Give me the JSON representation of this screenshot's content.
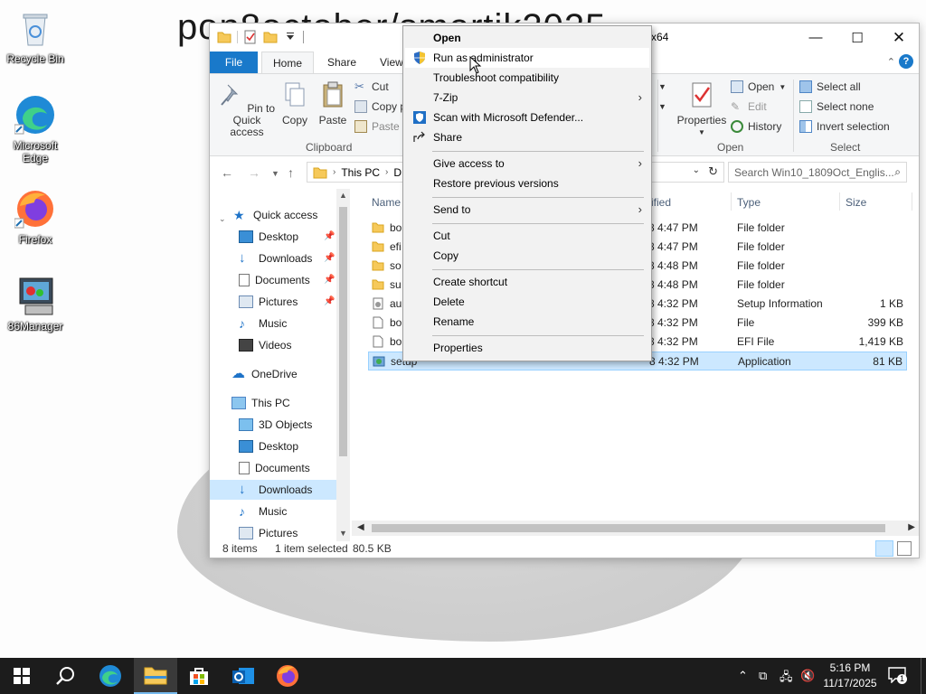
{
  "desktop": {
    "wallpaper_text": "pon8october/smartik2025",
    "icons": [
      {
        "label": "Recycle Bin",
        "icon": "recycle-bin-icon"
      },
      {
        "label": "Microsoft Edge",
        "icon": "edge-icon"
      },
      {
        "label": "Firefox",
        "icon": "firefox-icon"
      },
      {
        "label": "86Manager",
        "icon": "86manager-icon"
      }
    ]
  },
  "window": {
    "title": "x64",
    "controls": {
      "minimize": "—",
      "maximize": "☐",
      "close": "✕"
    },
    "tabs": [
      "File",
      "Home",
      "Share",
      "View"
    ],
    "active_tab": "Home",
    "ribbon": {
      "pin_label": "Pin to Quick access",
      "copy_label": "Copy",
      "paste_label": "Paste",
      "cut_label": "Cut",
      "copy_path_label": "Copy p",
      "paste_shortcut_label": "Paste s",
      "clipboard_group": "Clipboard",
      "properties_label": "Properties",
      "open_label": "Open",
      "edit_label": "Edit",
      "history_label": "History",
      "open_group": "Open",
      "select_all": "Select all",
      "select_none": "Select none",
      "invert_selection": "Invert selection",
      "select_group": "Select"
    },
    "address": {
      "path_root": "This PC",
      "path_next": "D"
    },
    "search_placeholder": "Search Win10_1809Oct_Englis...",
    "nav": {
      "quick_access": "Quick access",
      "quick_items": [
        "Desktop",
        "Downloads",
        "Documents",
        "Pictures",
        "Music",
        "Videos"
      ],
      "onedrive": "OneDrive",
      "this_pc": "This PC",
      "pc_items": [
        "3D Objects",
        "Desktop",
        "Documents",
        "Downloads",
        "Music",
        "Pictures"
      ],
      "selected": "Downloads"
    },
    "columns": {
      "name": "Name",
      "modified": "ified",
      "type": "Type",
      "size": "Size"
    },
    "files": [
      {
        "name": "bo",
        "modified": "8 4:47 PM",
        "type": "File folder",
        "size": "",
        "kind": "folder"
      },
      {
        "name": "efi",
        "modified": "8 4:47 PM",
        "type": "File folder",
        "size": "",
        "kind": "folder"
      },
      {
        "name": "so",
        "modified": "8 4:48 PM",
        "type": "File folder",
        "size": "",
        "kind": "folder"
      },
      {
        "name": "su",
        "modified": "8 4:48 PM",
        "type": "File folder",
        "size": "",
        "kind": "folder"
      },
      {
        "name": "au",
        "modified": "8 4:32 PM",
        "type": "Setup Information",
        "size": "1 KB",
        "kind": "inf"
      },
      {
        "name": "bo",
        "modified": "8 4:32 PM",
        "type": "File",
        "size": "399 KB",
        "kind": "file"
      },
      {
        "name": "bo",
        "modified": "8 4:32 PM",
        "type": "EFI File",
        "size": "1,419 KB",
        "kind": "file"
      },
      {
        "name": "setup",
        "modified": "8 4:32 PM",
        "type": "Application",
        "size": "81 KB",
        "kind": "app"
      }
    ],
    "status": {
      "count": "8 items",
      "selected": "1 item selected",
      "size": "80.5 KB"
    }
  },
  "context_menu": {
    "items": [
      {
        "label": "Open",
        "bold": true
      },
      {
        "label": "Run as administrator",
        "icon": "shield-icon",
        "hover": true
      },
      {
        "label": "Troubleshoot compatibility"
      },
      {
        "label": "7-Zip",
        "submenu": true
      },
      {
        "label": "Scan with Microsoft Defender...",
        "icon": "defender-icon"
      },
      {
        "label": "Share",
        "icon": "share-icon"
      },
      {
        "label": "Give access to",
        "submenu": true
      },
      {
        "label": "Restore previous versions"
      },
      {
        "label": "Send to",
        "submenu": true
      },
      {
        "label": "Cut"
      },
      {
        "label": "Copy"
      },
      {
        "label": "Create shortcut"
      },
      {
        "label": "Delete"
      },
      {
        "label": "Rename"
      },
      {
        "label": "Properties"
      }
    ]
  },
  "taskbar": {
    "apps": [
      "start-icon",
      "search-icon",
      "edge-icon",
      "file-explorer-icon",
      "store-icon",
      "outlook-icon",
      "firefox-icon"
    ],
    "time": "5:16 PM",
    "date": "11/17/2025",
    "notification_count": "1"
  }
}
